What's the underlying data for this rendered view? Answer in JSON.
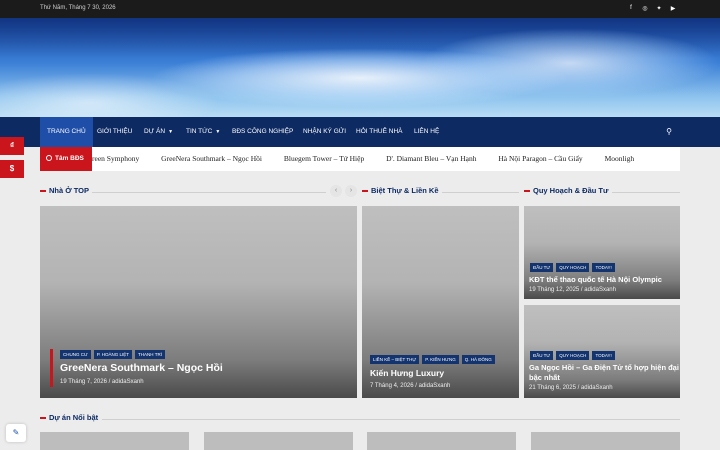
{
  "topbar": {
    "date": "Thứ Năm, Tháng 7 30, 2026",
    "social": [
      "facebook-icon",
      "instagram-icon",
      "twitter-icon",
      "youtube-icon"
    ]
  },
  "nav": {
    "items": [
      "TRANG CHỦ",
      "GIỚI THIỆU",
      "DỰ ÁN",
      "TIN TỨC",
      "BĐS CÔNG NGHIỆP",
      "NHẬN KÝ GỬI",
      "HỎI THUÊ NHÀ",
      "LIÊN HỆ"
    ]
  },
  "ticker": {
    "label": "Tâm BĐS",
    "items": [
      "reen Symphony",
      "GreeNera Southmark – Ngọc Hồi",
      "Bluegem Tower – Tứ Hiệp",
      "D'. Diamant Bleu – Vạn Hạnh",
      "Hà Nội Paragon – Cầu Giấy",
      "Moonligh"
    ]
  },
  "side_buttons": [
    "₫",
    "$"
  ],
  "sections": {
    "nha_o_top": "Nhà Ở TOP",
    "biet_thu": "Biệt Thự & Liền Kề",
    "quy_hoach": "Quy Hoạch & Đầu Tư",
    "du_an_noi_bat": "Dự án Nổi bật"
  },
  "main_card": {
    "tags": [
      "CHUNG CƯ",
      "P. HOÀNG LIỆT",
      "THANH TRÌ"
    ],
    "title": "GreeNera Southmark – Ngọc Hồi",
    "meta": "19 Tháng 7, 2026 / adidaSxanh"
  },
  "villa_card": {
    "tags": [
      "LIỀN KỀ – BIỆT THỰ",
      "P. KIẾN HƯNG",
      "Q. HÀ ĐÔNG"
    ],
    "title": "Kiến Hưng Luxury",
    "meta": "7 Tháng 4, 2026 / adidaSxanh"
  },
  "plan_cards": [
    {
      "tags": [
        "ĐẦU TƯ",
        "QUY HOẠCH",
        "TODAY!"
      ],
      "title": "KĐT thể thao quốc tế Hà Nội Olympic",
      "meta": "19 Tháng 12, 2025 / adidaSxanh"
    },
    {
      "tags": [
        "ĐẦU TƯ",
        "QUY HOẠCH",
        "TODAY!"
      ],
      "title1": "Ga Ngọc Hồi – Ga Điện Tử tổ hợp hiện đại",
      "title2": "bậc nhất",
      "meta": "21 Tháng 6, 2025 / adidaSxanh"
    }
  ],
  "colors": {
    "nav": "#0d2a63",
    "accent": "#c9151b",
    "active": "#1f4ea8"
  }
}
